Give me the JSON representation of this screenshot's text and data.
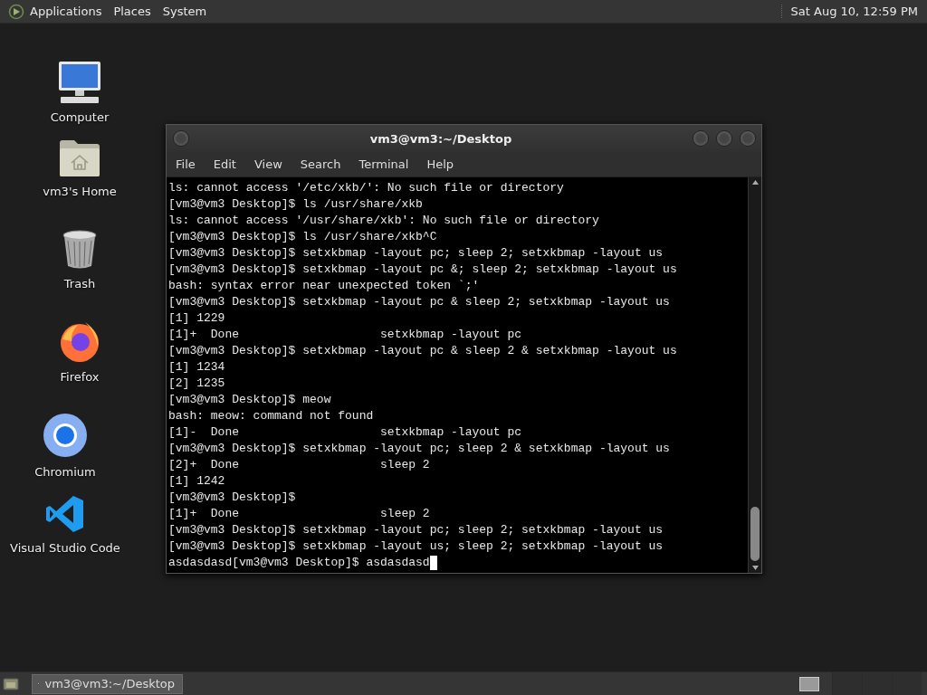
{
  "top_panel": {
    "menus": [
      "Applications",
      "Places",
      "System"
    ],
    "clock": "Sat Aug 10, 12:59 PM"
  },
  "desktop_icons": [
    {
      "kind": "computer",
      "label": "Computer"
    },
    {
      "kind": "home",
      "label": "vm3's Home"
    },
    {
      "kind": "trash",
      "label": "Trash"
    },
    {
      "kind": "firefox",
      "label": "Firefox"
    },
    {
      "kind": "chromium",
      "label": "Chromium"
    },
    {
      "kind": "vscode",
      "label": "Visual Studio Code"
    }
  ],
  "terminal": {
    "title": "vm3@vm3:~/Desktop",
    "menu": [
      "File",
      "Edit",
      "View",
      "Search",
      "Terminal",
      "Help"
    ],
    "lines": [
      "ls: cannot access '/etc/xkb/': No such file or directory",
      "[vm3@vm3 Desktop]$ ls /usr/share/xkb",
      "ls: cannot access '/usr/share/xkb': No such file or directory",
      "[vm3@vm3 Desktop]$ ls /usr/share/xkb^C",
      "[vm3@vm3 Desktop]$ setxkbmap -layout pc; sleep 2; setxkbmap -layout us",
      "[vm3@vm3 Desktop]$ setxkbmap -layout pc &; sleep 2; setxkbmap -layout us",
      "bash: syntax error near unexpected token `;'",
      "[vm3@vm3 Desktop]$ setxkbmap -layout pc & sleep 2; setxkbmap -layout us",
      "[1] 1229",
      "[1]+  Done                    setxkbmap -layout pc",
      "[vm3@vm3 Desktop]$ setxkbmap -layout pc & sleep 2 & setxkbmap -layout us",
      "[1] 1234",
      "[2] 1235",
      "[vm3@vm3 Desktop]$ meow",
      "bash: meow: command not found",
      "[1]-  Done                    setxkbmap -layout pc",
      "[vm3@vm3 Desktop]$ setxkbmap -layout pc; sleep 2 & setxkbmap -layout us",
      "[2]+  Done                    sleep 2",
      "[1] 1242",
      "[vm3@vm3 Desktop]$",
      "[1]+  Done                    sleep 2",
      "[vm3@vm3 Desktop]$ setxkbmap -layout pc; sleep 2; setxkbmap -layout us",
      "[vm3@vm3 Desktop]$ setxkbmap -layout us; sleep 2; setxkbmap -layout us",
      "asdasdasd[vm3@vm3 Desktop]$ asdasdasd"
    ]
  },
  "taskbar": {
    "tasks": [
      {
        "label": "vm3@vm3:~/Desktop",
        "selected": true
      }
    ]
  }
}
